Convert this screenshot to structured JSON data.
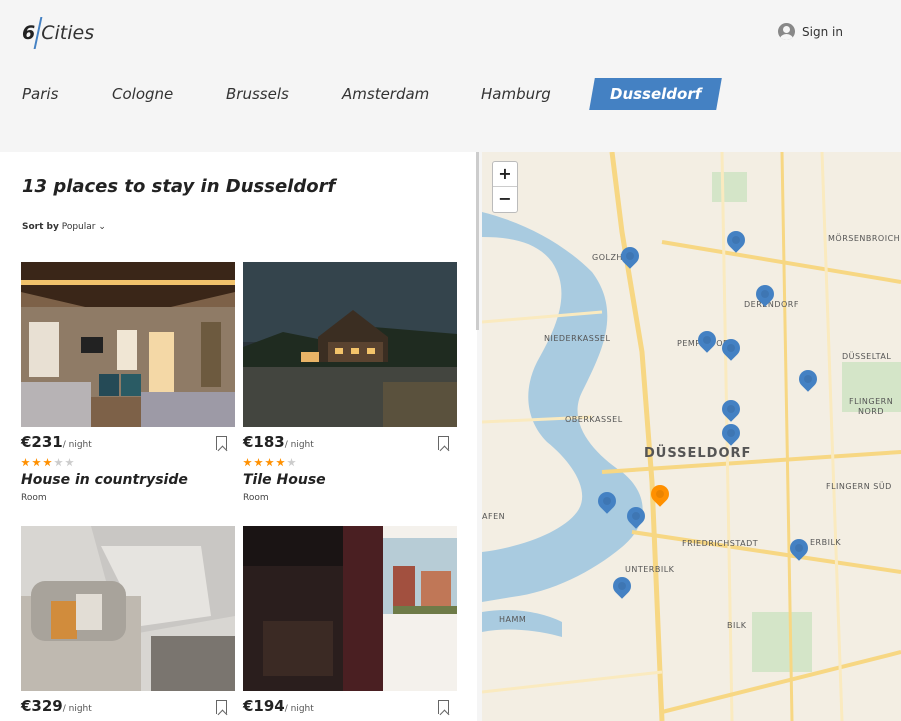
{
  "header": {
    "logo_number": "6",
    "logo_text": "Cities",
    "signin_label": "Sign in"
  },
  "tabs": [
    {
      "label": "Paris",
      "active": false
    },
    {
      "label": "Cologne",
      "active": false
    },
    {
      "label": "Brussels",
      "active": false
    },
    {
      "label": "Amsterdam",
      "active": false
    },
    {
      "label": "Hamburg",
      "active": false
    },
    {
      "label": "Dusseldorf",
      "active": true
    }
  ],
  "places": {
    "title": "13 places to stay in Dusseldorf",
    "sort_prefix": "Sort by",
    "sort_value": "Popular",
    "night_label": "/ night",
    "cards": [
      {
        "price": "€231",
        "rating": 3,
        "name": "House in countryside",
        "type": "Room"
      },
      {
        "price": "€183",
        "rating": 4,
        "name": "Tile House",
        "type": "Room"
      },
      {
        "price": "€329",
        "rating": null,
        "name": "",
        "type": ""
      },
      {
        "price": "€194",
        "rating": null,
        "name": "",
        "type": ""
      }
    ]
  },
  "map": {
    "zoom_in": "+",
    "zoom_out": "−",
    "labels": {
      "golzheim": "GOLZH",
      "morsenbroich": "MÖRSENBROICH",
      "derendorf": "DERENDORF",
      "niederkassel": "NIEDERKASSEL",
      "pempelfort": "PEMPELFORT",
      "dusseltal": "DÜSSELTAL",
      "flingern_nord_1": "FLINGERN",
      "flingern_nord_2": "NORD",
      "oberkassel": "OBERKASSEL",
      "dusseldorf": "DÜSSELDORF",
      "flingern_sud": "FLINGERN SÜD",
      "hafen": "AFEN",
      "friedrichstadt": "FRIEDRICHSTADT",
      "oberbilk": "ERBILK",
      "unterbilk": "UNTERBILK",
      "hamm": "HAMM",
      "bilk": "BILK"
    },
    "active_pin_color": "#ff9000",
    "pin_color": "#4481c3"
  },
  "colors": {
    "accent": "#4481c3",
    "star": "#ff9000"
  }
}
